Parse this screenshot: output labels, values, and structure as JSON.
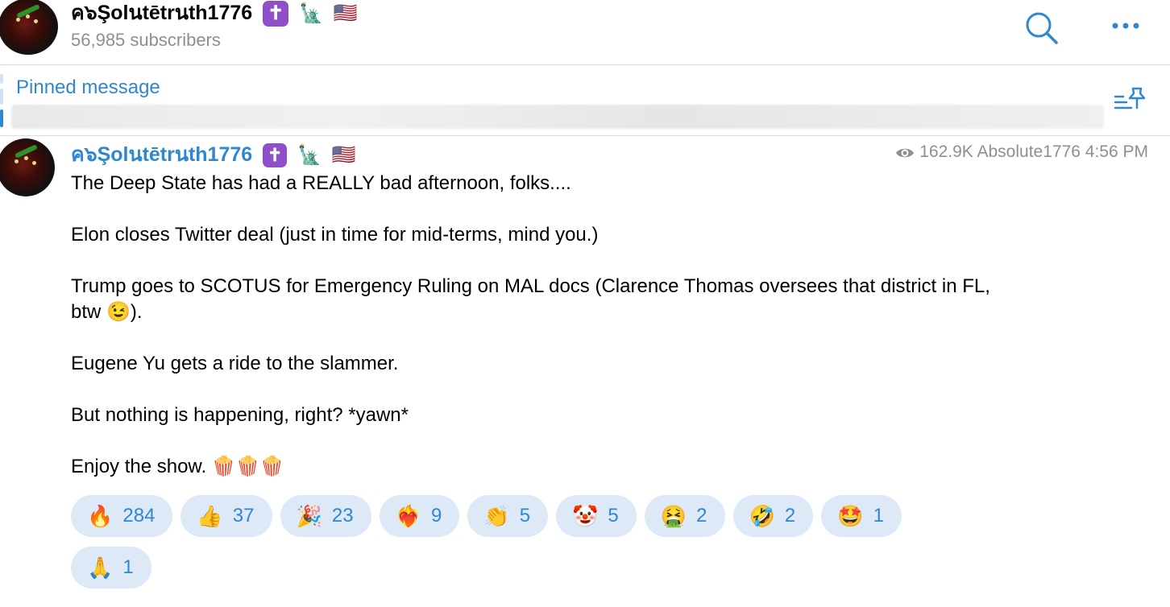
{
  "channel": {
    "name": "ค๖Şolนtētrนth1776",
    "badges": [
      "✝️",
      "🗽",
      "🇺🇸"
    ],
    "subscribers": "56,985 subscribers"
  },
  "header": {
    "search_icon": "search-icon",
    "more_icon": "more-icon"
  },
  "pinned": {
    "label": "Pinned message",
    "icon": "pinned-list-icon"
  },
  "message": {
    "author": "ค๖Şolนtētrนth1776",
    "author_badges": [
      "✝️",
      "🗽",
      "🇺🇸"
    ],
    "views": "162.9K",
    "signature": "Absolute1776",
    "time": "4:56 PM",
    "lines": [
      "The Deep State has had a REALLY bad afternoon, folks....",
      "Elon closes Twitter deal (just in time for mid-terms, mind you.)",
      "Trump goes to SCOTUS for Emergency Ruling on MAL docs (Clarence Thomas oversees that district in FL, btw 😉).",
      "Eugene Yu gets a ride to the slammer.",
      "But nothing is happening, right? *yawn*",
      "Enjoy the show. 🍿🍿🍿"
    ]
  },
  "reactions": [
    {
      "emoji": "🔥",
      "count": "284"
    },
    {
      "emoji": "👍",
      "count": "37"
    },
    {
      "emoji": "🎉",
      "count": "23"
    },
    {
      "emoji": "❤️‍🔥",
      "count": "9"
    },
    {
      "emoji": "👏",
      "count": "5"
    },
    {
      "emoji": "🤡",
      "count": "5"
    },
    {
      "emoji": "🤮",
      "count": "2"
    },
    {
      "emoji": "🤣",
      "count": "2"
    },
    {
      "emoji": "🤩",
      "count": "1"
    },
    {
      "emoji": "🙏",
      "count": "1"
    }
  ],
  "colors": {
    "accent": "#2f87d0",
    "reaction_bg": "#dde9f7",
    "muted": "#8e8e93"
  }
}
